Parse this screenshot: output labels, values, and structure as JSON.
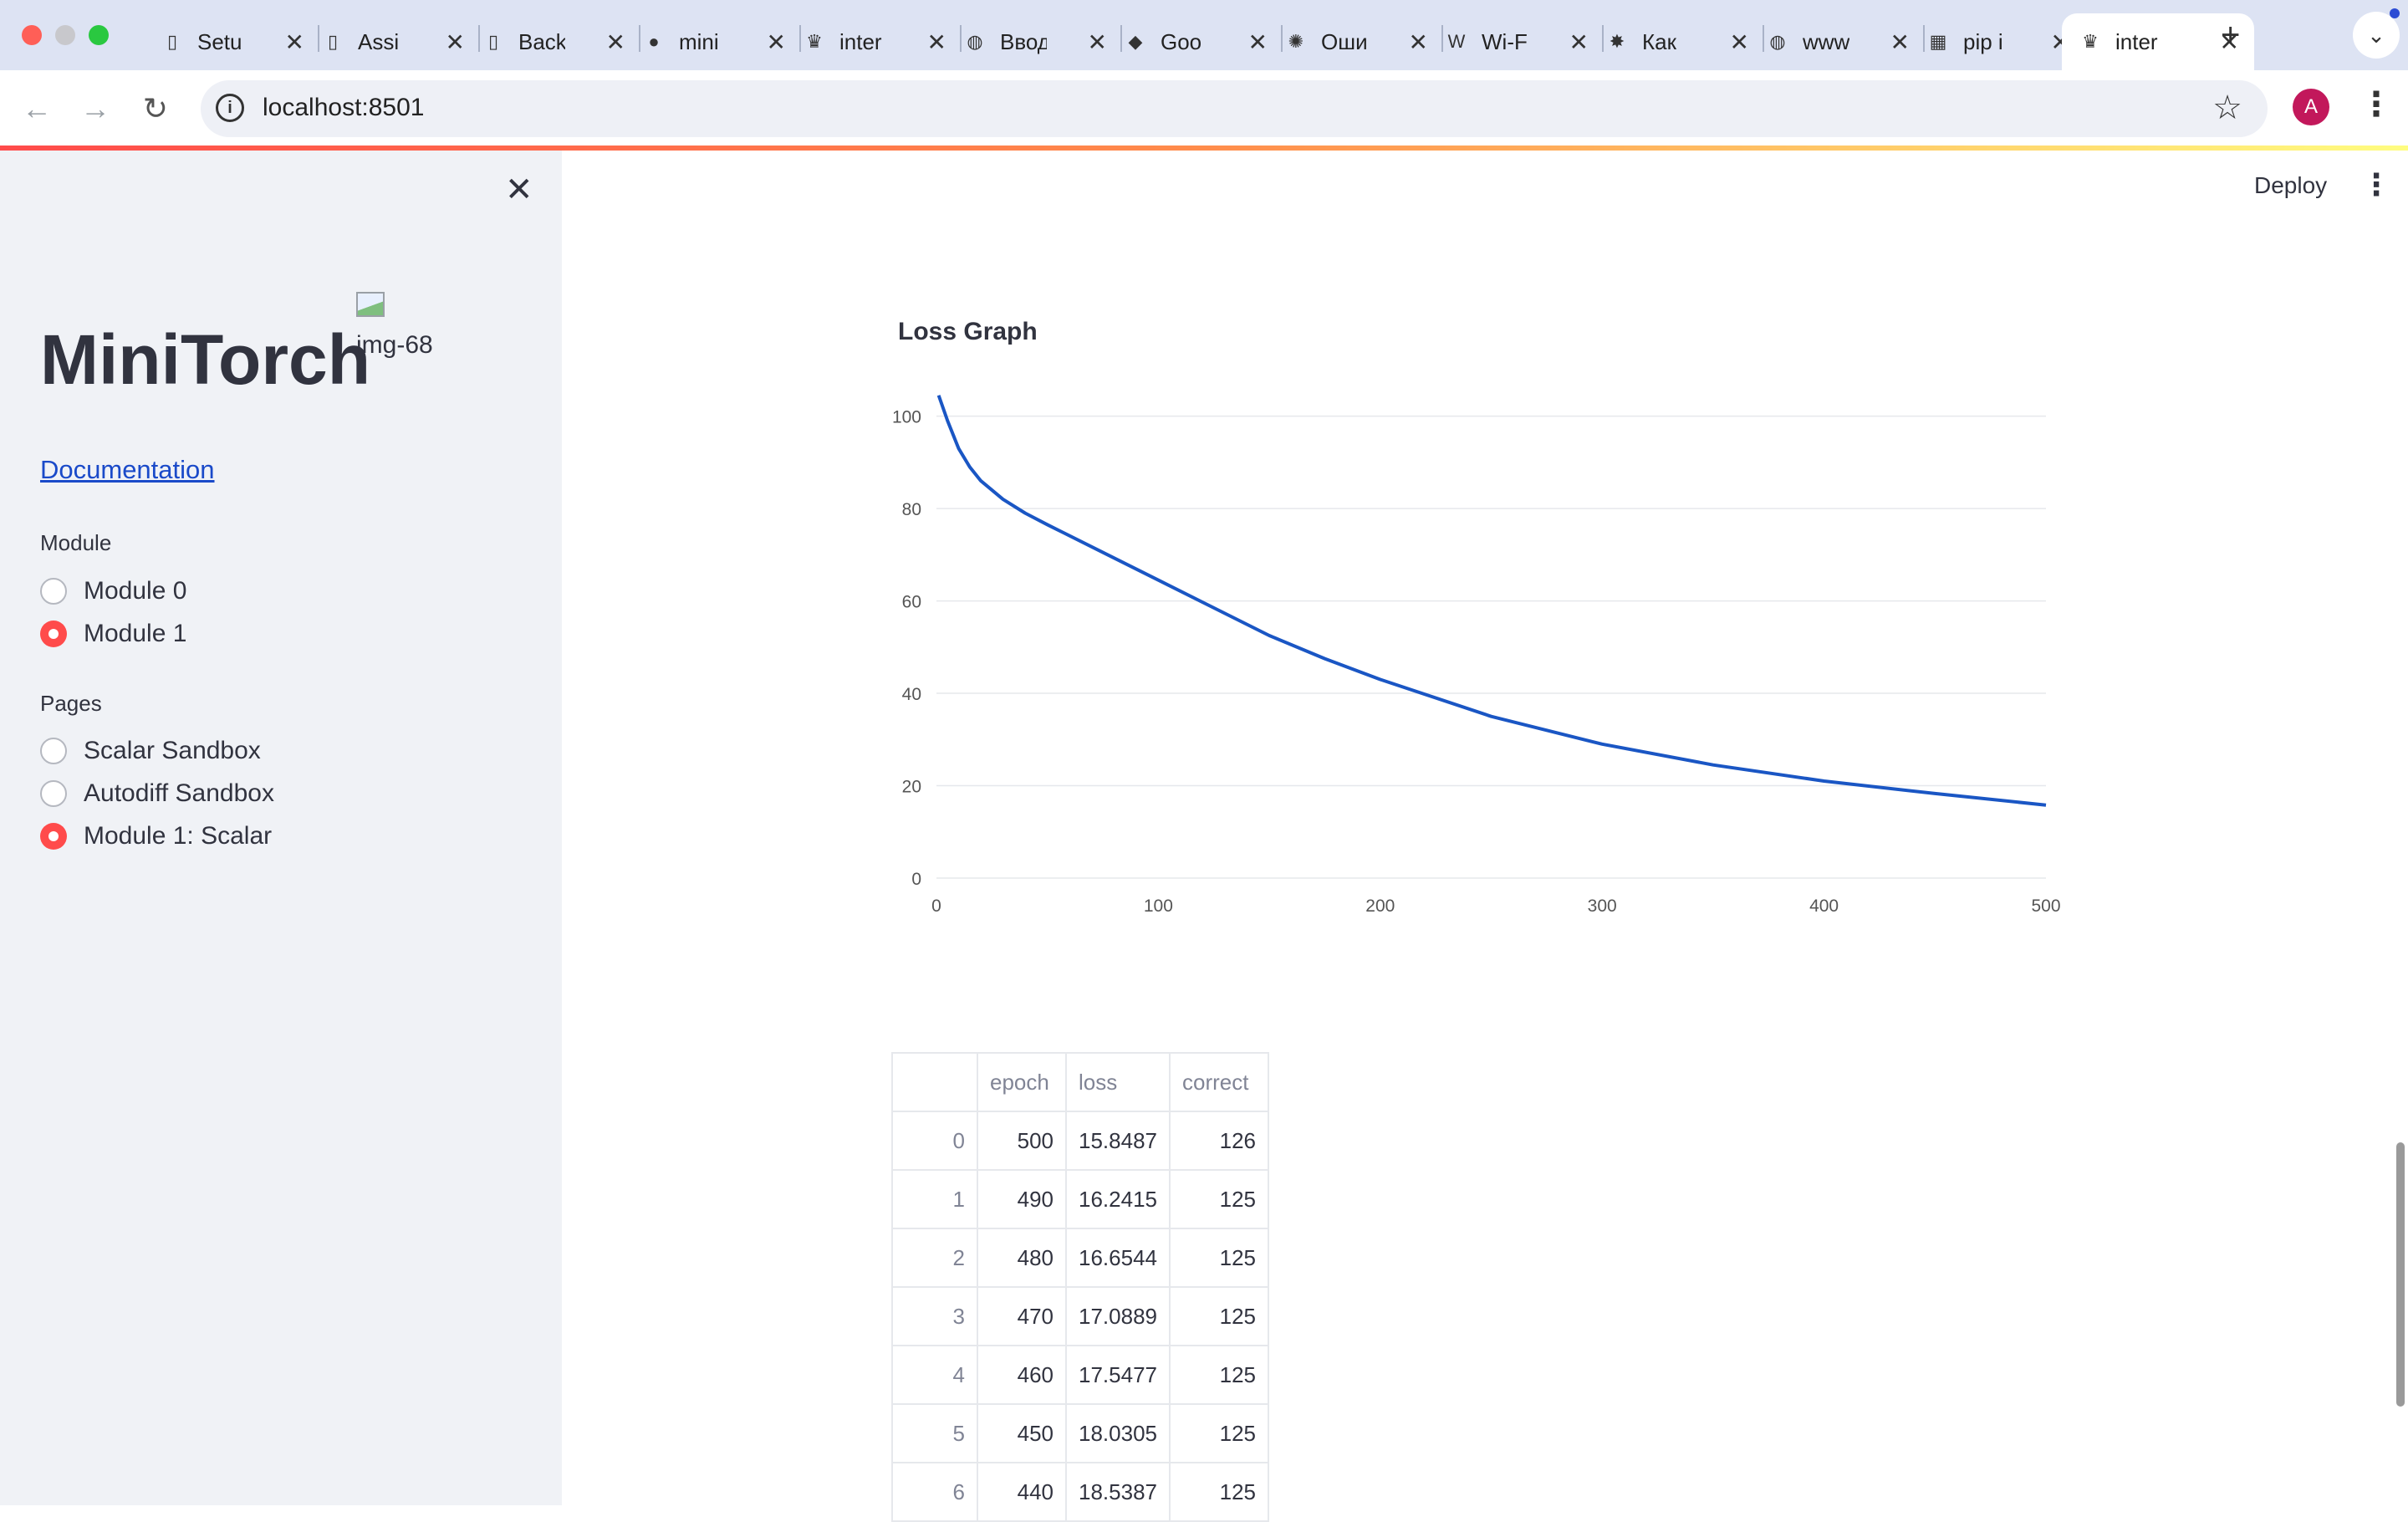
{
  "browser": {
    "tabs": [
      {
        "label": "Setu",
        "icon": "doc-icon"
      },
      {
        "label": "Assi",
        "icon": "doc-icon"
      },
      {
        "label": "Back",
        "icon": "doc-icon"
      },
      {
        "label": "mini",
        "icon": "github-icon"
      },
      {
        "label": "inter",
        "icon": "crown-icon"
      },
      {
        "label": "Ввод",
        "icon": "globe-icon"
      },
      {
        "label": "Goo",
        "icon": "google-icon"
      },
      {
        "label": "Оши",
        "icon": "openai-icon"
      },
      {
        "label": "Wi-F",
        "icon": "wikipedia-icon"
      },
      {
        "label": "Как",
        "icon": "star-icon"
      },
      {
        "label": "www",
        "icon": "globe-icon"
      },
      {
        "label": "pip i",
        "icon": "grid-icon"
      },
      {
        "label": "inter",
        "icon": "crown-icon",
        "active": true
      }
    ],
    "url": "localhost:8501",
    "profile_initial": "A"
  },
  "sidebar": {
    "title": "MiniTorch",
    "image_alt": "img-68",
    "doc_link": "Documentation",
    "module_label": "Module",
    "modules": [
      {
        "label": "Module 0",
        "selected": false
      },
      {
        "label": "Module 1",
        "selected": true
      }
    ],
    "pages_label": "Pages",
    "pages": [
      {
        "label": "Scalar Sandbox",
        "selected": false
      },
      {
        "label": "Autodiff Sandbox",
        "selected": false
      },
      {
        "label": "Module 1: Scalar",
        "selected": true
      }
    ]
  },
  "header": {
    "deploy_label": "Deploy"
  },
  "main": {
    "chart_title": "Loss Graph",
    "table": {
      "columns": [
        "",
        "epoch",
        "loss",
        "correct"
      ],
      "rows": [
        [
          "0",
          "500",
          "15.8487",
          "126"
        ],
        [
          "1",
          "490",
          "16.2415",
          "125"
        ],
        [
          "2",
          "480",
          "16.6544",
          "125"
        ],
        [
          "3",
          "470",
          "17.0889",
          "125"
        ],
        [
          "4",
          "460",
          "17.5477",
          "125"
        ],
        [
          "5",
          "450",
          "18.0305",
          "125"
        ],
        [
          "6",
          "440",
          "18.5387",
          "125"
        ]
      ]
    }
  },
  "chart_data": {
    "type": "line",
    "title": "Loss Graph",
    "xlabel": "",
    "ylabel": "",
    "xlim": [
      0,
      500
    ],
    "ylim": [
      0,
      105
    ],
    "x_ticks": [
      0,
      100,
      200,
      300,
      400,
      500
    ],
    "y_ticks": [
      0,
      20,
      40,
      60,
      80,
      100
    ],
    "grid": "horizontal",
    "color": "#1a56c4",
    "series": [
      {
        "x": [
          1,
          5,
          10,
          15,
          20,
          30,
          40,
          50,
          75,
          100,
          125,
          150,
          175,
          200,
          250,
          300,
          350,
          400,
          450,
          500
        ],
        "values": [
          104.5,
          99,
          93,
          89,
          86,
          82,
          79,
          76.5,
          70.5,
          64.5,
          58.5,
          52.5,
          47.5,
          43,
          35,
          29,
          24.5,
          21,
          18.3,
          15.8
        ]
      }
    ]
  }
}
